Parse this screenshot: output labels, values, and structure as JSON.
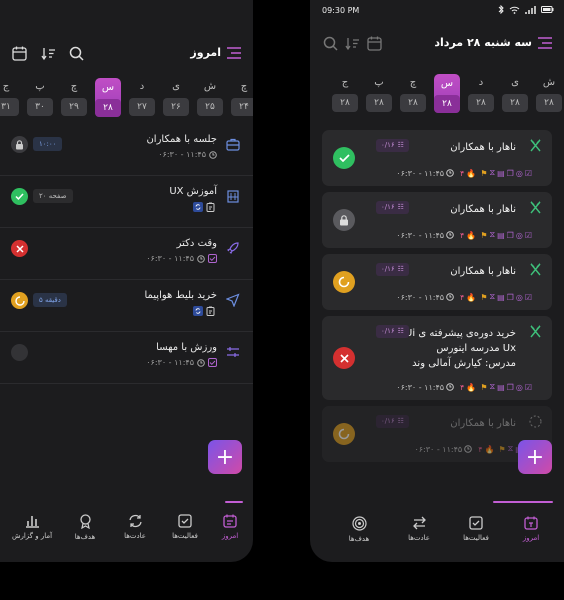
{
  "left": {
    "header_title": "امروز",
    "days": [
      {
        "name": "چ",
        "num": "۲۴"
      },
      {
        "name": "ش",
        "num": "۲۵"
      },
      {
        "name": "ی",
        "num": "۲۶"
      },
      {
        "name": "د",
        "num": "۲۷"
      },
      {
        "name": "س",
        "num": "۲۸",
        "selected": true
      },
      {
        "name": "چ",
        "num": "۲۹"
      },
      {
        "name": "پ",
        "num": "۳۰"
      },
      {
        "name": "ج",
        "num": "۳۱"
      }
    ],
    "tasks": [
      {
        "title": "جلسه با همکاران",
        "time": "۰۶:۳۰ - ۱۱:۴۵",
        "badge": "۱۰:۰۰",
        "status": "locked"
      },
      {
        "title": "آموزش UX",
        "time": "",
        "badge": "۲۰ صفحه",
        "status": "done"
      },
      {
        "title": "وقت دکتر",
        "time": "۰۶:۳۰ - ۱۱:۴۵",
        "badge": "",
        "status": "failed"
      },
      {
        "title": "خرید بلیط هواپیما",
        "time": "",
        "badge": "۵ دقیقه",
        "status": "partial"
      },
      {
        "title": "ورزش با مهسا",
        "time": "۰۶:۳۰ - ۱۱:۴۵",
        "badge": "",
        "status": "empty"
      }
    ],
    "nav": [
      "امروز",
      "فعالیت‌ها",
      "عادت‌ها",
      "هدف‌ها",
      "آمار و گزارش"
    ]
  },
  "right": {
    "status_time": "09:30 PM",
    "header_title": "سه شنبه ۲۸ مرداد",
    "days": [
      {
        "name": "ش",
        "num": "۲۸"
      },
      {
        "name": "ی",
        "num": "۲۸"
      },
      {
        "name": "د",
        "num": "۲۸"
      },
      {
        "name": "س",
        "num": "۲۸",
        "selected": true
      },
      {
        "name": "چ",
        "num": "۲۸"
      },
      {
        "name": "پ",
        "num": "۲۸"
      },
      {
        "name": "ج",
        "num": "۲۸"
      }
    ],
    "cards": [
      {
        "title": "ناهار با همکاران",
        "badge": "۰/۱۶",
        "time": "۰۶:۳۰ - ۱۱:۴۵",
        "count": "۴",
        "status": "done"
      },
      {
        "title": "ناهار با همکاران",
        "badge": "۰/۱۶",
        "time": "۰۶:۳۰ - ۱۱:۴۵",
        "count": "۴",
        "status": "locked"
      },
      {
        "title": "ناهار با همکاران",
        "badge": "۰/۱۶",
        "time": "۰۶:۳۰ - ۱۱:۴۵",
        "count": "۴",
        "status": "partial"
      },
      {
        "title": "خرید دوره‌ی پیشرفته ی Ui/",
        "title2": "Ux مدرسه اینورس",
        "title3": "مدرس: کیارش آمالی وند",
        "badge": "۰/۱۶",
        "time": "۰۶:۳۰ - ۱۱:۴۵",
        "count": "۴",
        "status": "failed"
      },
      {
        "title": "ناهار با همکاران",
        "badge": "۰/۱۶",
        "time": "۰۶:۳۰ - ۱۱:۴۵",
        "count": "۴",
        "status": "partial"
      }
    ],
    "nav": [
      "امروز",
      "فعالیت‌ها",
      "عادت‌ها",
      "هدف‌ها"
    ]
  },
  "colors": {
    "accent": "#c25ed4",
    "done": "#2fbf60",
    "failed": "#d43030",
    "partial": "#e0a020",
    "locked": "#5a5a5e"
  }
}
